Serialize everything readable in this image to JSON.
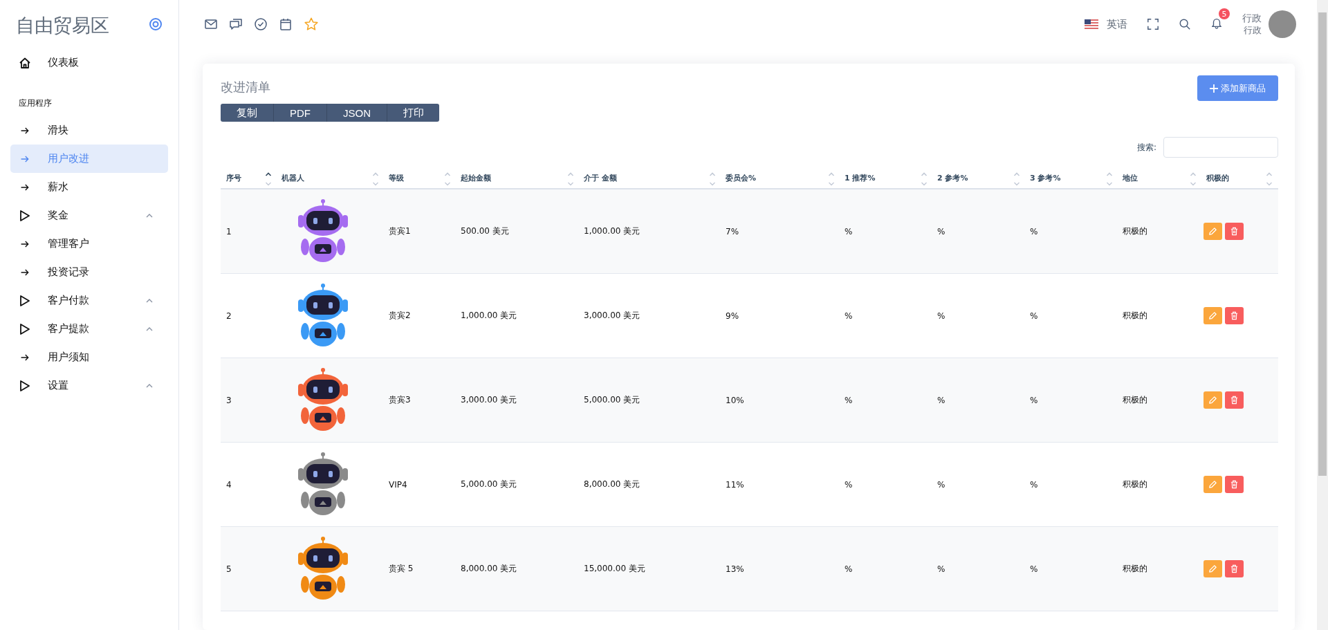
{
  "sidebar": {
    "brand": "自由贸易区",
    "items": [
      {
        "kind": "home",
        "label": "仪表板",
        "selected": false
      },
      {
        "kind": "section",
        "label": "应用程序"
      },
      {
        "kind": "link",
        "label": "滑块",
        "selected": false
      },
      {
        "kind": "link",
        "label": "用户改进",
        "selected": true
      },
      {
        "kind": "link",
        "label": "薪水",
        "selected": false
      },
      {
        "kind": "group",
        "label": "奖金",
        "selected": false
      },
      {
        "kind": "link",
        "label": "管理客户",
        "selected": false
      },
      {
        "kind": "link",
        "label": "投资记录",
        "selected": false
      },
      {
        "kind": "group",
        "label": "客户付款",
        "selected": false
      },
      {
        "kind": "group",
        "label": "客户提款",
        "selected": false
      },
      {
        "kind": "link",
        "label": "用户须知",
        "selected": false
      },
      {
        "kind": "group",
        "label": "设置",
        "selected": false
      }
    ]
  },
  "topbar": {
    "language": "英语",
    "notifications": "5",
    "user_name": "行政",
    "user_role": "行政"
  },
  "card": {
    "title": "改进清单",
    "export_buttons": [
      "复制",
      "PDF",
      "JSON",
      "打印"
    ],
    "add_button": "添加新商品",
    "search_label": "搜索:"
  },
  "table": {
    "columns": [
      {
        "label": "序号",
        "sorted": true
      },
      {
        "label": "机器人",
        "sorted": false
      },
      {
        "label": "等级",
        "sorted": false
      },
      {
        "label": "起始金额",
        "sorted": false
      },
      {
        "label": "介于 金额",
        "sorted": false
      },
      {
        "label": "委员会%",
        "sorted": false
      },
      {
        "label": "1 推荐%",
        "sorted": false
      },
      {
        "label": "2 参考%",
        "sorted": false
      },
      {
        "label": "3 参考%",
        "sorted": false
      },
      {
        "label": "地位",
        "sorted": false
      },
      {
        "label": "积极的",
        "sorted": false
      }
    ],
    "rows": [
      {
        "no": "1",
        "color": "#a56cf0",
        "level": "贵宾1",
        "start": "500.00 美元",
        "range": "1,000.00 美元",
        "commission": "7%",
        "ref1": "%",
        "ref2": "%",
        "ref3": "%",
        "status": "积极的"
      },
      {
        "no": "2",
        "color": "#3b9af5",
        "level": "贵宾2",
        "start": "1,000.00 美元",
        "range": "3,000.00 美元",
        "commission": "9%",
        "ref1": "%",
        "ref2": "%",
        "ref3": "%",
        "status": "积极的"
      },
      {
        "no": "3",
        "color": "#f2643a",
        "level": "贵宾3",
        "start": "3,000.00 美元",
        "range": "5,000.00 美元",
        "commission": "10%",
        "ref1": "%",
        "ref2": "%",
        "ref3": "%",
        "status": "积极的"
      },
      {
        "no": "4",
        "color": "#8a8a8a",
        "level": "VIP4",
        "start": "5,000.00 美元",
        "range": "8,000.00 美元",
        "commission": "11%",
        "ref1": "%",
        "ref2": "%",
        "ref3": "%",
        "status": "积极的"
      },
      {
        "no": "5",
        "color": "#f08a14",
        "level": "贵宾 5",
        "start": "8,000.00 美元",
        "range": "15,000.00 美元",
        "commission": "13%",
        "ref1": "%",
        "ref2": "%",
        "ref3": "%",
        "status": "积极的"
      }
    ]
  }
}
